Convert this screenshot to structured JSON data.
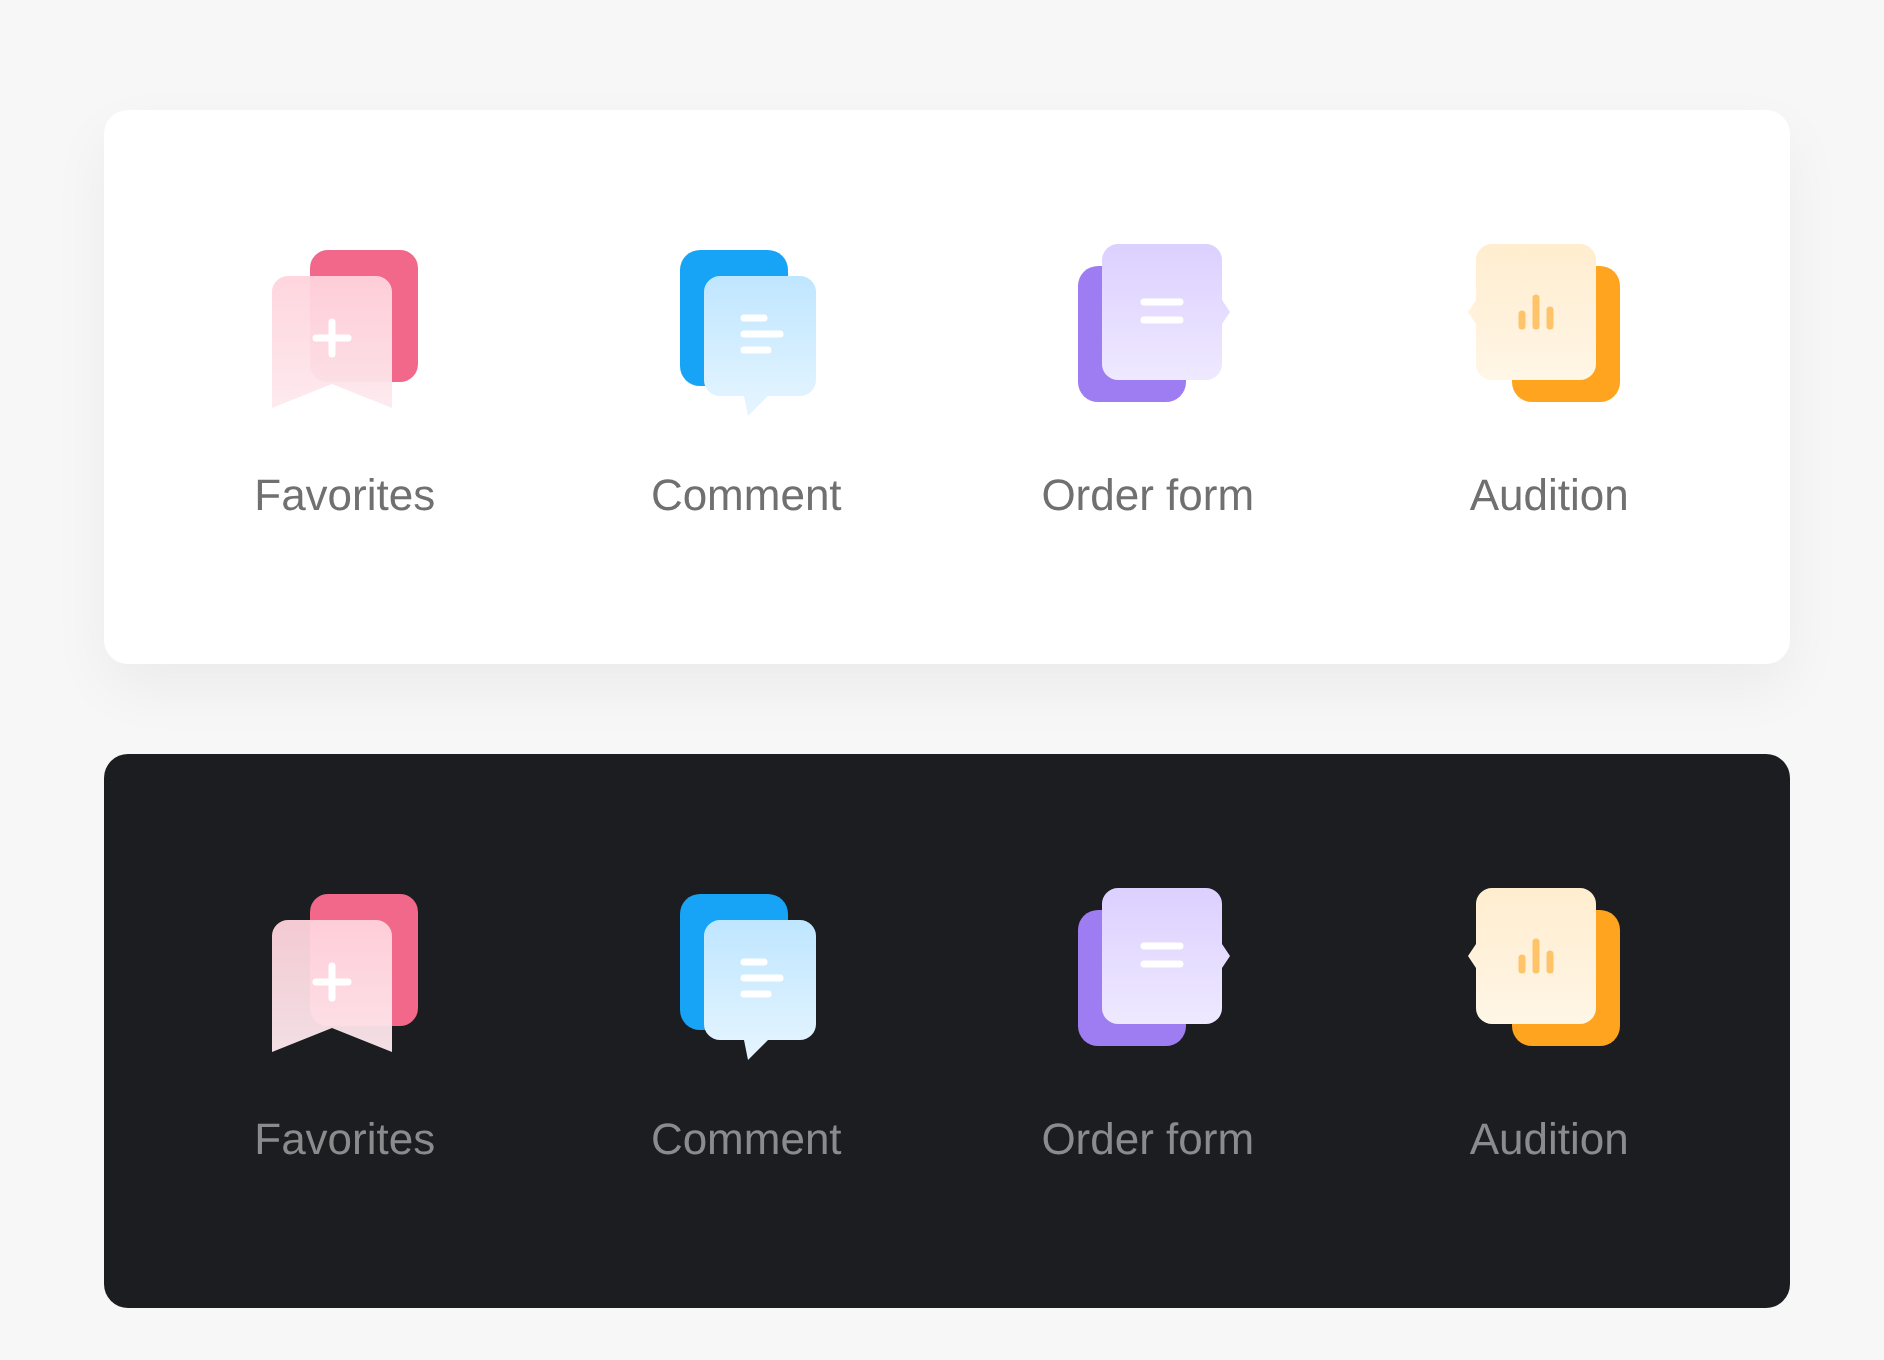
{
  "panels": [
    {
      "dark": false,
      "items": [
        {
          "kind": "favorites",
          "label": "Favorites"
        },
        {
          "kind": "comment",
          "label": "Comment"
        },
        {
          "kind": "order",
          "label": "Order form"
        },
        {
          "kind": "audition",
          "label": "Audition"
        }
      ]
    },
    {
      "dark": true,
      "items": [
        {
          "kind": "favorites",
          "label": "Favorites"
        },
        {
          "kind": "comment",
          "label": "Comment"
        },
        {
          "kind": "order",
          "label": "Order form"
        },
        {
          "kind": "audition",
          "label": "Audition"
        }
      ]
    }
  ]
}
